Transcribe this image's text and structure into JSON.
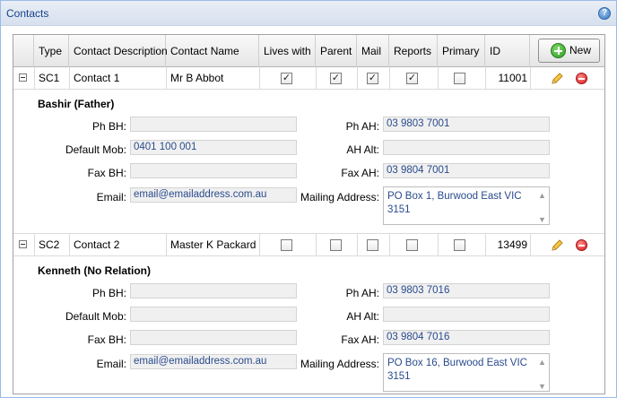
{
  "panel": {
    "title": "Contacts",
    "help_icon": "help-icon"
  },
  "header": {
    "columns": [
      "Type",
      "Contact Description",
      "Contact Name",
      "Lives with",
      "Parent",
      "Mail",
      "Reports",
      "Primary",
      "ID"
    ],
    "new_label": "New"
  },
  "contacts": [
    {
      "type": "SC1",
      "description": "Contact 1",
      "name": "Mr B Abbot",
      "lives_with": true,
      "parent": true,
      "mail": true,
      "reports": true,
      "primary": false,
      "id": "11001",
      "detail_name": "Bashir (Father)",
      "fields": {
        "ph_bh_label": "Ph BH:",
        "ph_bh": "",
        "default_mob_label": "Default Mob:",
        "default_mob": "0401 100 001",
        "fax_bh_label": "Fax BH:",
        "fax_bh": "",
        "email_label": "Email:",
        "email": "email@emailaddress.com.au",
        "ph_ah_label": "Ph AH:",
        "ph_ah": "03 9803 7001",
        "ah_alt_label": "AH Alt:",
        "ah_alt": "",
        "fax_ah_label": "Fax AH:",
        "fax_ah": "03 9804 7001",
        "mailing_label": "Mailing Address:",
        "mailing_line1": "PO Box 1, Burwood East VIC",
        "mailing_line2": "3151"
      }
    },
    {
      "type": "SC2",
      "description": "Contact 2",
      "name": "Master K Packard",
      "lives_with": false,
      "parent": false,
      "mail": false,
      "reports": false,
      "primary": false,
      "id": "13499",
      "detail_name": "Kenneth (No Relation)",
      "fields": {
        "ph_bh_label": "Ph BH:",
        "ph_bh": "",
        "default_mob_label": "Default Mob:",
        "default_mob": "",
        "fax_bh_label": "Fax BH:",
        "fax_bh": "",
        "email_label": "Email:",
        "email": "email@emailaddress.com.au",
        "ph_ah_label": "Ph AH:",
        "ph_ah": "03 9803 7016",
        "ah_alt_label": "AH Alt:",
        "ah_alt": "",
        "fax_ah_label": "Fax AH:",
        "fax_ah": "03 9804 7016",
        "mailing_label": "Mailing Address:",
        "mailing_line1": "PO Box 16, Burwood East VIC",
        "mailing_line2": "3151"
      }
    }
  ],
  "colors": {
    "header_text": "#15428b",
    "field_text": "#2a4b8d",
    "add": "#2e9d22",
    "delete": "#d21b1b"
  },
  "icons": {
    "add": "plus-circle-icon",
    "edit": "pencil-icon",
    "delete": "minus-circle-icon",
    "expand": "collapse-icon"
  }
}
